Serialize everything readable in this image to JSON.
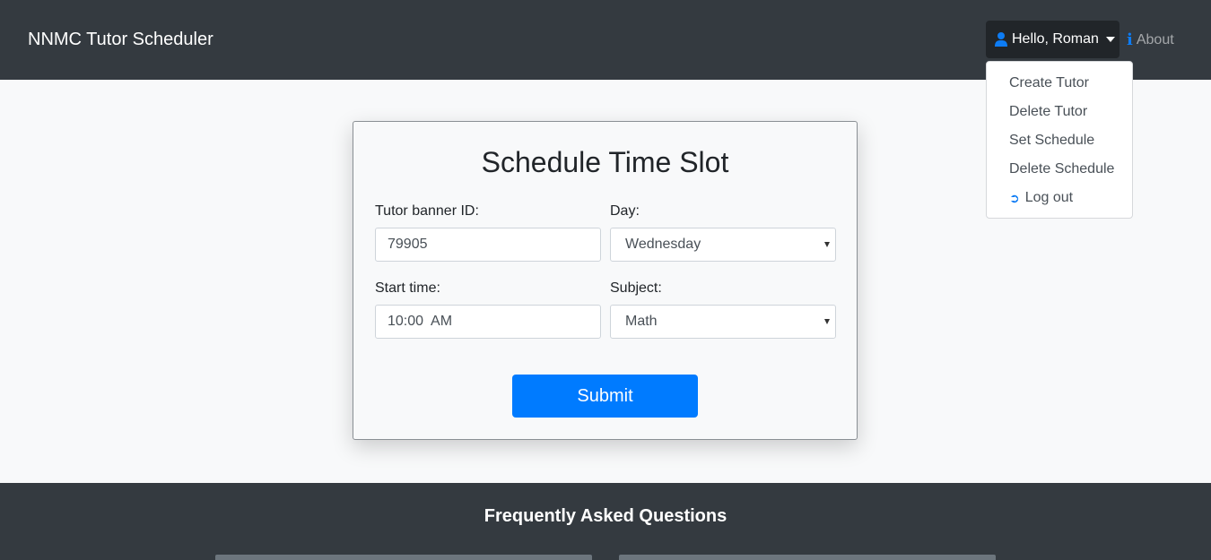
{
  "navbar": {
    "brand": "NNMC Tutor Scheduler",
    "user_menu_label": "Hello, Roman",
    "about_label": "About"
  },
  "dropdown": {
    "items": [
      "Create Tutor",
      "Delete Tutor",
      "Set Schedule",
      "Delete Schedule"
    ],
    "logout_label": "Log out"
  },
  "form": {
    "title": "Schedule Time Slot",
    "tutor_id_label": "Tutor banner ID:",
    "tutor_id_value": "79905",
    "day_label": "Day:",
    "day_value": "Wednesday",
    "start_time_label": "Start time:",
    "start_time_value": "10:00  AM",
    "subject_label": "Subject:",
    "subject_value": "Math",
    "submit_label": "Submit"
  },
  "footer": {
    "faq_title": "Frequently Asked Questions"
  },
  "colors": {
    "navbar": "#343a40",
    "accent": "#007bff",
    "background": "#f8f9fa"
  }
}
